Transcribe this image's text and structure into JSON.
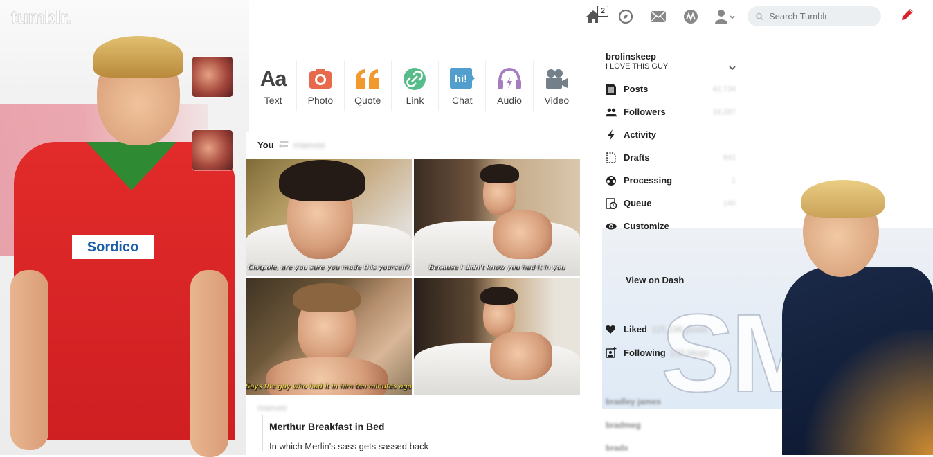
{
  "topbar": {
    "logo": "tumblr.",
    "search_placeholder": "Search Tumblr",
    "home_badge": "2",
    "icons": [
      "home-icon",
      "explore-icon",
      "inbox-icon",
      "activity-icon",
      "account-icon",
      "compose-icon"
    ],
    "compose_color": "#d9222a"
  },
  "post_types": [
    {
      "label": "Text",
      "icon": "text-icon",
      "color": "#444444"
    },
    {
      "label": "Photo",
      "icon": "photo-icon",
      "color": "#e86a4c"
    },
    {
      "label": "Quote",
      "icon": "quote-icon",
      "color": "#f2992e"
    },
    {
      "label": "Link",
      "icon": "link-icon",
      "color": "#56bc8a"
    },
    {
      "label": "Chat",
      "icon": "chat-icon",
      "color": "#529ecc"
    },
    {
      "label": "Audio",
      "icon": "audio-icon",
      "color": "#a77dc2"
    },
    {
      "label": "Video",
      "icon": "video-icon",
      "color": "#748089"
    }
  ],
  "post": {
    "you_label": "You",
    "reblogged_from": "maevee",
    "gifs": [
      {
        "caption": "Clotpole, are you sure you made this yourself?",
        "style": "white"
      },
      {
        "caption": "Because I didn't know you had it in you",
        "style": "white"
      },
      {
        "caption": "Says the guy who had it in him ten minutes ago",
        "style": "yellow"
      },
      {
        "caption": "",
        "style": "white"
      }
    ],
    "author": "maevee",
    "quote_title": "Merthur Breakfast in Bed",
    "quote_body": "In which Merlin's sass gets sassed back"
  },
  "sidebar": {
    "blog_name": "brolinskeep",
    "blog_title": "I LOVE THIS GUY",
    "items": [
      {
        "label": "Posts",
        "icon": "posts-icon",
        "count": "42,734"
      },
      {
        "label": "Followers",
        "icon": "followers-icon",
        "count": "16,287"
      },
      {
        "label": "Activity",
        "icon": "activity-bolt-icon",
        "count": ""
      },
      {
        "label": "Drafts",
        "icon": "drafts-icon",
        "count": "842"
      },
      {
        "label": "Processing",
        "icon": "processing-icon",
        "count": "1"
      },
      {
        "label": "Queue",
        "icon": "queue-icon",
        "count": "140"
      },
      {
        "label": "Customize",
        "icon": "eye-icon",
        "count": ""
      }
    ],
    "view_on_dash": "View on Dash",
    "liked_label": "Liked",
    "liked_count": "115,196 posts",
    "following_label": "Following",
    "following_count": "133 blogs",
    "other_blogs": [
      "bradley james",
      "bradmeg",
      "bradx"
    ]
  }
}
